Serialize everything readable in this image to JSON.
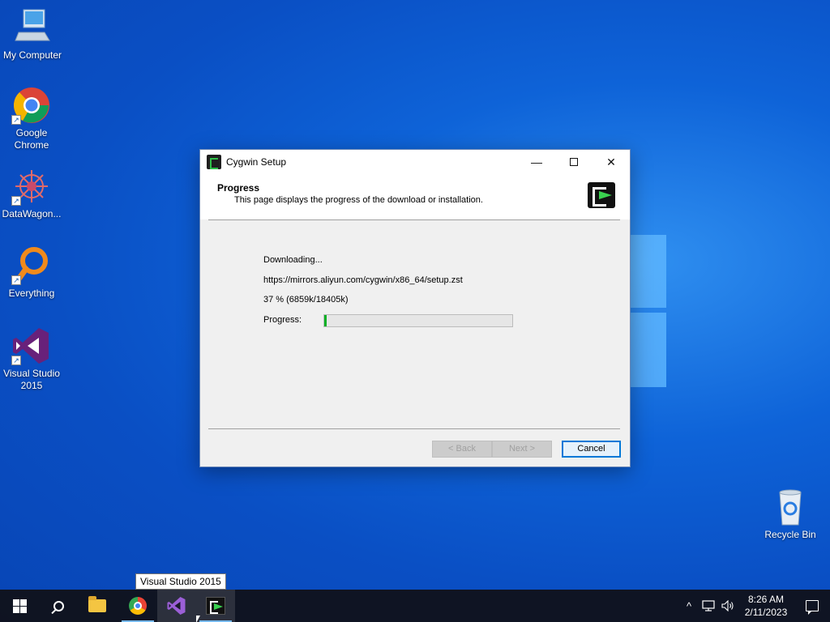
{
  "desktop": {
    "icons": [
      {
        "label": "My Computer",
        "icon": "computer-icon"
      },
      {
        "label": "Google Chrome",
        "icon": "chrome-icon"
      },
      {
        "label": "DataWagon...",
        "icon": "datawagon-icon"
      },
      {
        "label": "Everything",
        "icon": "everything-search-icon"
      },
      {
        "label": "Visual Studio 2015",
        "icon": "visual-studio-icon"
      },
      {
        "label": "Recycle Bin",
        "icon": "recycle-bin-icon"
      }
    ]
  },
  "dialog": {
    "title": "Cygwin Setup",
    "controls": {
      "minimize": "—",
      "maximize": "☐",
      "close": "✕"
    },
    "header": {
      "title": "Progress",
      "description": "This page displays the progress of the download or installation."
    },
    "status": "Downloading...",
    "url": "https://mirrors.aliyun.com/cygwin/x86_64/setup.zst",
    "progress_text": "37 %  (6859k/18405k)",
    "progress_label": "Progress:",
    "progress_fraction": 0.015,
    "buttons": {
      "back": "< Back",
      "next": "Next >",
      "cancel": "Cancel"
    }
  },
  "tooltip": "Visual Studio 2015",
  "taskbar": {
    "items": [
      {
        "name": "start",
        "icon": "windows-start-icon"
      },
      {
        "name": "search",
        "icon": "search-icon"
      },
      {
        "name": "file-explorer",
        "icon": "folder-icon"
      },
      {
        "name": "chrome",
        "icon": "chrome-icon"
      },
      {
        "name": "visual-studio",
        "icon": "visual-studio-icon"
      },
      {
        "name": "cygwin",
        "icon": "cygwin-icon"
      }
    ],
    "tray": {
      "chevron": "^",
      "time": "8:26 AM",
      "date": "2/11/2023"
    }
  },
  "colors": {
    "desktop_blue": "#0a4fc4",
    "progress_green": "#06b025",
    "focus_blue": "#0078d7"
  }
}
